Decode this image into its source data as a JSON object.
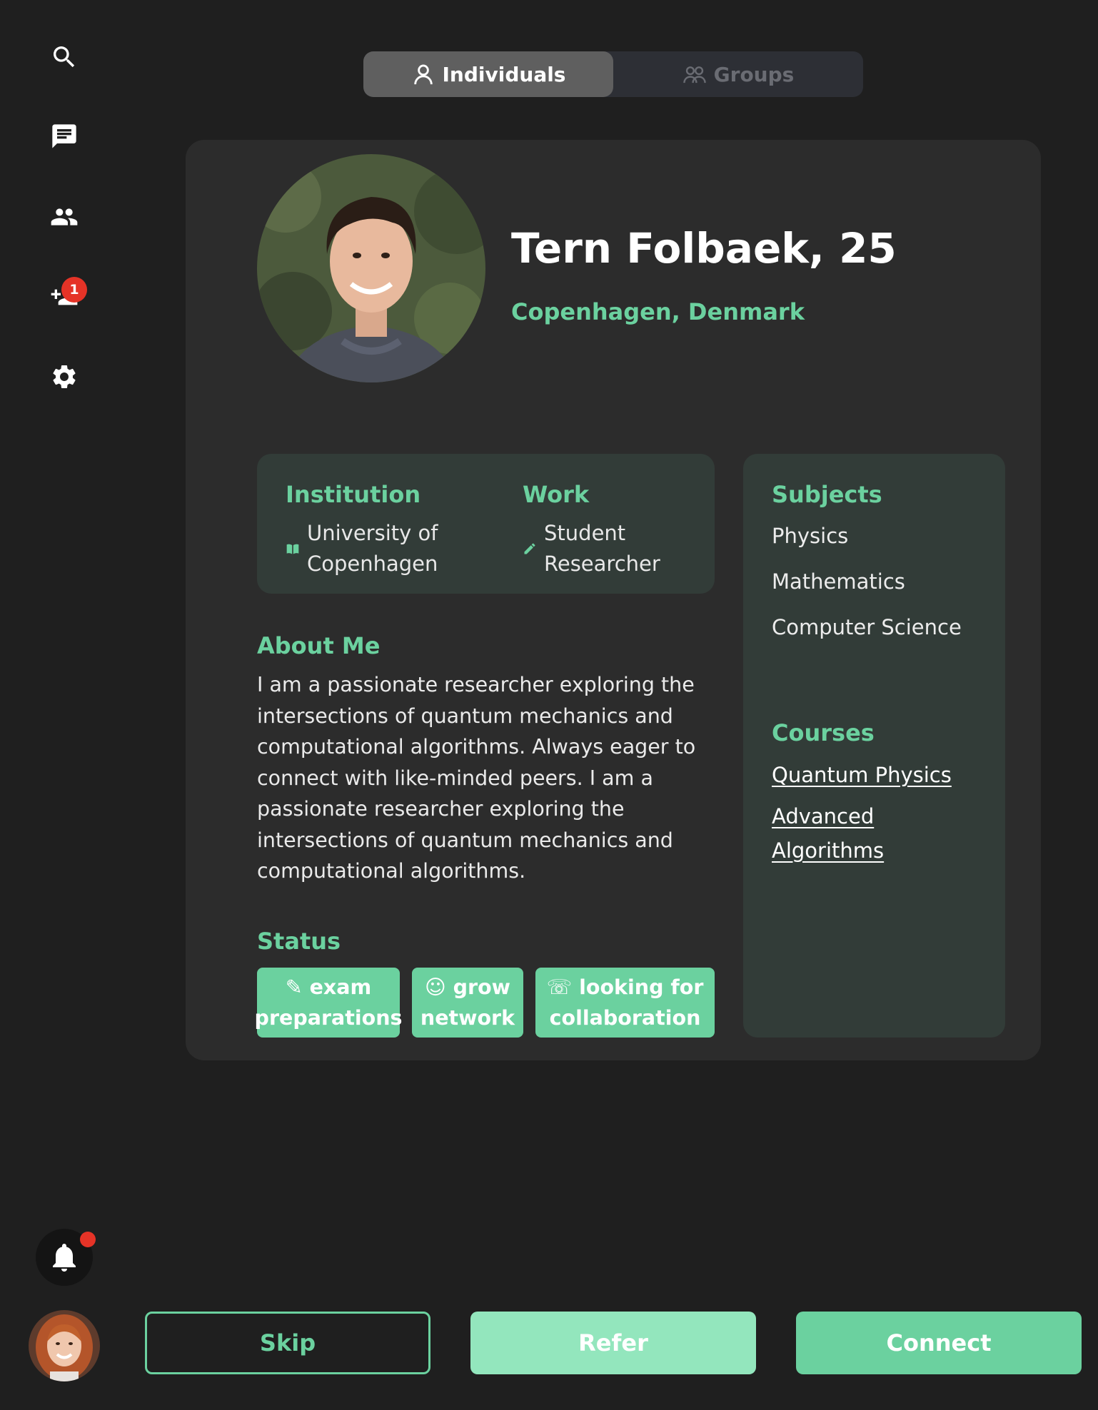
{
  "sidebar": {
    "items": [
      {
        "name": "search",
        "icon": "search-icon"
      },
      {
        "name": "messages",
        "icon": "chat-icon"
      },
      {
        "name": "people",
        "icon": "people-icon"
      },
      {
        "name": "requests",
        "icon": "people-add-icon",
        "badge": "1"
      },
      {
        "name": "settings",
        "icon": "gear-icon"
      }
    ],
    "notification_icon": "bell-icon",
    "has_unread": true
  },
  "toggle": {
    "individuals": "Individuals",
    "groups": "Groups",
    "active": "individuals"
  },
  "profile": {
    "name": "Tern Folbaek, 25",
    "location": "Copenhagen, Denmark",
    "institution_label": "Institution",
    "institution_value": "University of Copenhagen",
    "work_label": "Work",
    "work_value": "Student Researcher",
    "about_title": "About Me",
    "about_text": "I am a passionate researcher exploring the intersections of quantum mechanics and computational algorithms. Always eager to connect with like-minded peers. I am a passionate researcher exploring the intersections of quantum mechanics and computational algorithms.",
    "status_title": "Status",
    "status": [
      {
        "label": "✎ exam preparations"
      },
      {
        "label": "☺ grow network"
      },
      {
        "label": "☏ looking for collaboration"
      }
    ],
    "subjects_title": "Subjects",
    "subjects": [
      "Physics",
      "Mathematics",
      "Computer Science"
    ],
    "courses_title": "Courses",
    "courses": [
      "Quantum Physics",
      "Advanced Algorithms"
    ]
  },
  "actions": {
    "skip": "Skip",
    "refer": "Refer",
    "connect": "Connect"
  },
  "colors": {
    "background": "#1f1f1f",
    "card": "#2c2c2c",
    "panel": "#323c38",
    "accent": "#6bd19f",
    "accent_light": "#93e6bd",
    "badge": "#e53327"
  }
}
